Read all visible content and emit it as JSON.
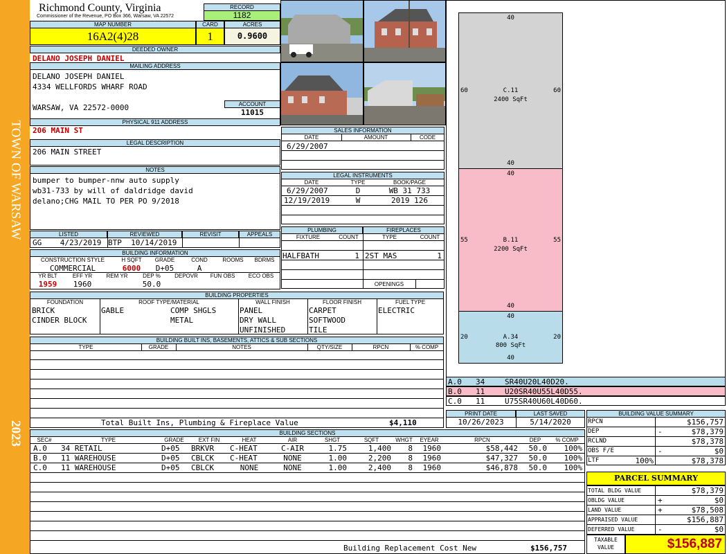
{
  "sidebar": {
    "town": "TOWN OF WARSAW",
    "year": "2023",
    "color": "#f5a623"
  },
  "header": {
    "county": "Richmond County, Virginia",
    "commissioner": "Commissioner of the Revenue, PO Box 366, Warsaw, VA 22572",
    "record_label": "RECORD",
    "record": "1182",
    "map_number_label": "MAP NUMBER",
    "map_number": "16A2(4)28",
    "card_label": "CARD",
    "card": "1",
    "acres_label": "ACRES",
    "acres": "0.9600"
  },
  "owner": {
    "deeded_label": "DEEDED OWNER",
    "deeded": "DELANO JOSEPH DANIEL",
    "mailing_label": "MAILING ADDRESS",
    "mailing_lines": [
      "DELANO JOSEPH DANIEL",
      "4334 WELLFORDS WHARF ROAD",
      "",
      "WARSAW, VA 22572-0000"
    ],
    "account_label": "ACCOUNT",
    "account": "11015",
    "physical_label": "PHYSICAL 911 ADDRESS",
    "physical": "206 MAIN ST"
  },
  "legal": {
    "label": "LEGAL DESCRIPTION",
    "text": "206 MAIN STREET"
  },
  "notes": {
    "label": "NOTES",
    "lines": [
      "bumper to bumper-nnw auto supply",
      "wb31-733 by will of daldridge david",
      "delano;CHG MAIL TO PER PO 9/2018"
    ]
  },
  "listing": {
    "labels": [
      "LISTED",
      "REVIEWED",
      "REVISIT",
      "APPEALS"
    ],
    "listed": "GG    4/23/2019",
    "reviewed": "BTP  10/14/2019",
    "revisit": "",
    "appeals": ""
  },
  "building_info": {
    "label": "BUILDING INFORMATION",
    "cols1": [
      "CONSTRUCTION STYLE",
      "H SQFT",
      "GRADE",
      "COND",
      "ROOMS",
      "BDRMS"
    ],
    "style": "COMMERCIAL",
    "hsqft": "6000",
    "grade": "D+05",
    "cond": "A",
    "rooms": "",
    "bdrms": "",
    "cols2": [
      "YR BLT",
      "EFF YR",
      "REM YR",
      "DEP %",
      "DEPOVR",
      "FUN OBS",
      "ECO OBS"
    ],
    "yrblt": "1959",
    "effyr": "1960",
    "remyr": "",
    "dep": "50.0",
    "depovr": "",
    "funobs": "",
    "ecoobs": ""
  },
  "building_props": {
    "label": "BUILDING PROPERTIES",
    "cols": [
      "FOUNDATION",
      "ROOF TYPE/MATERIAL",
      "WALL FINISH",
      "FLOOR FINISH",
      "FUEL TYPE"
    ],
    "foundation": [
      "BRICK",
      "CINDER BLOCK"
    ],
    "roof_type": [
      "GABLE"
    ],
    "roof_material": [
      "COMP SHGLS",
      "METAL"
    ],
    "wall": [
      "PANEL",
      "DRY WALL",
      "UNFINISHED"
    ],
    "floor": [
      "CARPET",
      "SOFTWOOD",
      "TILE"
    ],
    "fuel": [
      "ELECTRIC"
    ]
  },
  "built_ins": {
    "label": "BUILDING BUILT INS, BASEMENTS, ATTICS & SUB SECTIONS",
    "cols": [
      "TYPE",
      "GRADE",
      "NOTES",
      "QTY/SIZE",
      "RPCN",
      "% COMP"
    ],
    "total_label": "Total Built Ins, Plumbing & Fireplace Value",
    "total": "$4,110"
  },
  "sales": {
    "label": "SALES INFORMATION",
    "cols": [
      "DATE",
      "AMOUNT",
      "CODE"
    ],
    "rows": [
      [
        "6/29/2007",
        "",
        ""
      ]
    ]
  },
  "instruments": {
    "label": "LEGAL INSTRUMENTS",
    "cols": [
      "DATE",
      "TYPE",
      "BOOK/PAGE"
    ],
    "rows": [
      [
        "6/29/2007",
        "D",
        "WB 31 733"
      ],
      [
        "12/19/2019",
        "W",
        "2019 126"
      ]
    ]
  },
  "plumbing": {
    "label": "PLUMBING",
    "cols": [
      "FIXTURE",
      "COUNT"
    ],
    "rows": [
      [
        "HALFBATH",
        "1"
      ]
    ]
  },
  "fireplaces": {
    "label": "FIREPLACES",
    "cols": [
      "TYPE",
      "COUNT"
    ],
    "rows": [
      [
        "2ST MAS",
        "1"
      ]
    ],
    "openings_label": "OPENINGS"
  },
  "sketch": {
    "sections": [
      {
        "name": "C.11",
        "area": "2400 SqFt",
        "top": "40",
        "bottom": "40",
        "left": "60",
        "right": "60",
        "color": "#d3d3d3"
      },
      {
        "name": "B.11",
        "area": "2200 SqFt",
        "top": "40",
        "bottom": "40",
        "left": "55",
        "right": "55",
        "color": "#f8bcc8"
      },
      {
        "name": "A.34",
        "area": "800 SqFt",
        "top": "40",
        "bottom": "40",
        "left": "20",
        "right": "20",
        "color": "#b8dcea"
      }
    ],
    "legend": [
      {
        "code": "A.0",
        "num": "34",
        "desc": "SR40U20L40D20.",
        "color": "#b8dcea"
      },
      {
        "code": "B.0",
        "num": "11",
        "desc": "U20SR40U55L40D55.",
        "color": "#f8bcc8"
      },
      {
        "code": "C.0",
        "num": "11",
        "desc": "U75SR40U60L40D60.",
        "color": "#ffffff"
      }
    ]
  },
  "print": {
    "print_label": "PRINT DATE",
    "print": "10/26/2023",
    "saved_label": "LAST SAVED",
    "saved": "5/14/2020"
  },
  "sections": {
    "label": "BUILDING SECTIONS",
    "cols": [
      "SEC#",
      "TYPE",
      "GRADE",
      "EXT FIN",
      "HEAT",
      "AIR",
      "SHGT",
      "SQFT",
      "WHGT",
      "EYEAR",
      "RPCN",
      "DEP",
      "% COMP"
    ],
    "rows": [
      [
        "A.0",
        "34 RETAIL",
        "D+05",
        "BRKVR",
        "C-HEAT",
        "C-AIR",
        "1.75",
        "1,400",
        "8",
        "1960",
        "$58,442",
        "50.0",
        "100%"
      ],
      [
        "B.0",
        "11 WAREHOUSE",
        "D+05",
        "CBLCK",
        "C-HEAT",
        "NONE",
        "1.00",
        "2,200",
        "8",
        "1960",
        "$47,327",
        "50.0",
        "100%"
      ],
      [
        "C.0",
        "11 WAREHOUSE",
        "D+05",
        "CBLCK",
        "NONE",
        "NONE",
        "1.00",
        "2,400",
        "8",
        "1960",
        "$46,878",
        "50.0",
        "100%"
      ]
    ],
    "total_label": "Building Replacement Cost New",
    "total": "$156,757"
  },
  "value_summary": {
    "label": "BUILDING VALUE SUMMARY",
    "rows": [
      {
        "k": "RPCN",
        "s": "",
        "v": "$156,757"
      },
      {
        "k": "DEP",
        "s": "-",
        "v": "$78,379"
      },
      {
        "k": "RCLND",
        "s": "",
        "v": "$78,378"
      },
      {
        "k": "OBS F/E",
        "s": "-",
        "v": "$0"
      },
      {
        "k": "LTF",
        "pct": "100%",
        "s": "",
        "v": "$78,378"
      }
    ]
  },
  "parcel": {
    "label": "PARCEL SUMMARY",
    "rows": [
      {
        "k": "TOTAL BLDG VALUE",
        "s": "",
        "v": "$78,379"
      },
      {
        "k": "OBLDG VALUE",
        "s": "+",
        "v": "$0"
      },
      {
        "k": "LAND VALUE",
        "s": "+",
        "v": "$78,508"
      },
      {
        "k": "APPRAISED VALUE",
        "s": "",
        "v": "$156,887"
      },
      {
        "k": "DEFERRED VALUE",
        "s": "-",
        "v": "$0"
      }
    ],
    "taxable_label": "TAXABLE VALUE",
    "taxable": "$156,887"
  },
  "photos": [
    {
      "name": "photo-warehouse-truck",
      "sky": "#9ec2e4",
      "fg": "#8a8a80",
      "bld": "#a9a9a9"
    },
    {
      "name": "photo-brick-front",
      "sky": "#a8c8ea",
      "fg": "#7d7d76",
      "bld": "#b5634e"
    },
    {
      "name": "photo-brick-side",
      "sky": "#8fb7e0",
      "fg": "#6f6f6a",
      "bld": "#b86a55"
    },
    {
      "name": "photo-warehouse-lot",
      "sky": "#b9d3ec",
      "fg": "#7c7870",
      "bld": "#d9d9d9"
    }
  ]
}
